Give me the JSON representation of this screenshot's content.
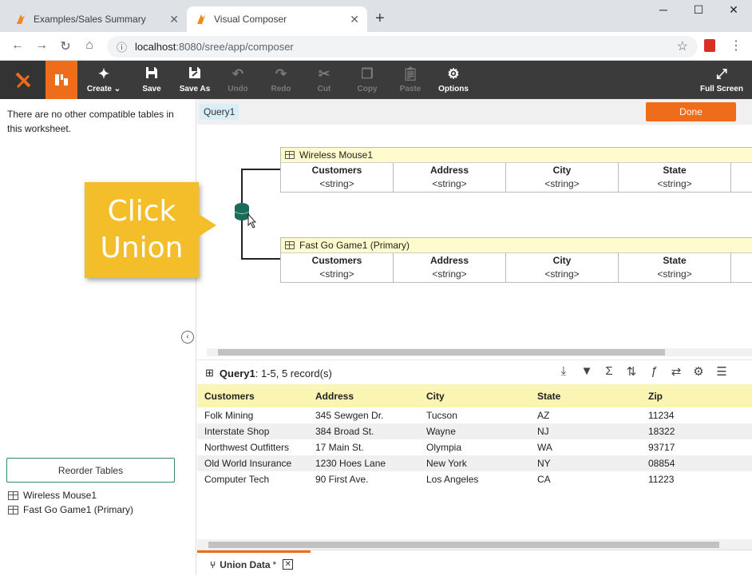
{
  "browser": {
    "tabs": [
      {
        "title": "Examples/Sales Summary",
        "active": false
      },
      {
        "title": "Visual Composer",
        "active": true
      }
    ],
    "url_host": "localhost",
    "url_path": ":8080/sree/app/composer"
  },
  "toolbar": {
    "create": "Create",
    "save": "Save",
    "save_as": "Save As",
    "undo": "Undo",
    "redo": "Redo",
    "cut": "Cut",
    "copy": "Copy",
    "paste": "Paste",
    "options": "Options",
    "full_screen": "Full Screen"
  },
  "left_panel": {
    "message": "There are no other compatible tables in this worksheet.",
    "reorder_label": "Reorder Tables",
    "tables": [
      "Wireless Mouse1",
      "Fast Go Game1 (Primary)"
    ]
  },
  "callout": {
    "line1": "Click",
    "line2": "Union"
  },
  "composer": {
    "query_tab": "Query1",
    "done_label": "Done",
    "tables": [
      {
        "name": "Wireless Mouse1",
        "columns": [
          {
            "name": "Customers",
            "type": "<string>"
          },
          {
            "name": "Address",
            "type": "<string>"
          },
          {
            "name": "City",
            "type": "<string>"
          },
          {
            "name": "State",
            "type": "<string>"
          }
        ]
      },
      {
        "name": "Fast Go Game1 (Primary)",
        "columns": [
          {
            "name": "Customers",
            "type": "<string>"
          },
          {
            "name": "Address",
            "type": "<string>"
          },
          {
            "name": "City",
            "type": "<string>"
          },
          {
            "name": "State",
            "type": "<string>"
          }
        ]
      }
    ]
  },
  "results": {
    "query_name": "Query1",
    "summary": ": 1-5, 5 record(s)",
    "headers": [
      "Customers",
      "Address",
      "City",
      "State",
      "Zip"
    ],
    "rows": [
      [
        "Folk Mining",
        "345 Sewgen Dr.",
        "Tucson",
        "AZ",
        "11234"
      ],
      [
        "Interstate Shop",
        "384 Broad St.",
        "Wayne",
        "NJ",
        "18322"
      ],
      [
        "Northwest Outfitters",
        "17 Main St.",
        "Olympia",
        "WA",
        "93717"
      ],
      [
        "Old World Insurance",
        "1230 Hoes Lane",
        "New York",
        "NY",
        "08854"
      ],
      [
        "Computer Tech",
        "90 First Ave.",
        "Los Angeles",
        "CA",
        "11223"
      ]
    ]
  },
  "bottom_tab": {
    "label": "Union Data",
    "modified_marker": "*"
  },
  "colors": {
    "accent": "#ef6c1a",
    "toolbar_bg": "#3b3b3b",
    "callout": "#f4be2a",
    "union_node": "#1a6b5a",
    "table_header": "#fffbcc"
  }
}
